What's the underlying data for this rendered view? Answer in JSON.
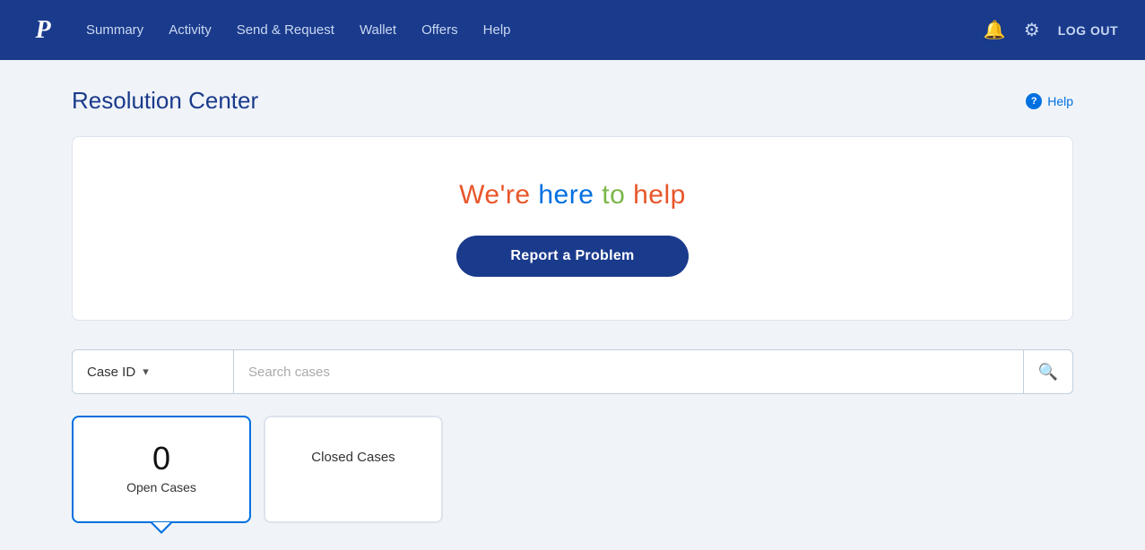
{
  "header": {
    "logo_text": "P",
    "nav": [
      {
        "label": "Summary",
        "id": "summary"
      },
      {
        "label": "Activity",
        "id": "activity"
      },
      {
        "label": "Send & Request",
        "id": "send-request"
      },
      {
        "label": "Wallet",
        "id": "wallet"
      },
      {
        "label": "Offers",
        "id": "offers"
      },
      {
        "label": "Help",
        "id": "help"
      }
    ],
    "logout_label": "LOG OUT",
    "bell_icon": "🔔",
    "gear_icon": "⚙"
  },
  "page": {
    "title": "Resolution Center",
    "help_label": "Help"
  },
  "hero": {
    "title_part1": "We're ",
    "title_part2": "here ",
    "title_part3": "to ",
    "title_part4": "help",
    "report_btn": "Report a Problem"
  },
  "search": {
    "filter_label": "Case ID",
    "placeholder": "Search cases"
  },
  "tabs": [
    {
      "id": "open",
      "count": "0",
      "label": "Open Cases",
      "active": true
    },
    {
      "id": "closed",
      "label": "Closed Cases",
      "active": false
    }
  ],
  "colors": {
    "brand_blue": "#1a3a8c",
    "accent_blue": "#0070e0",
    "accent_red": "#e8562a",
    "accent_green": "#7ab648"
  }
}
